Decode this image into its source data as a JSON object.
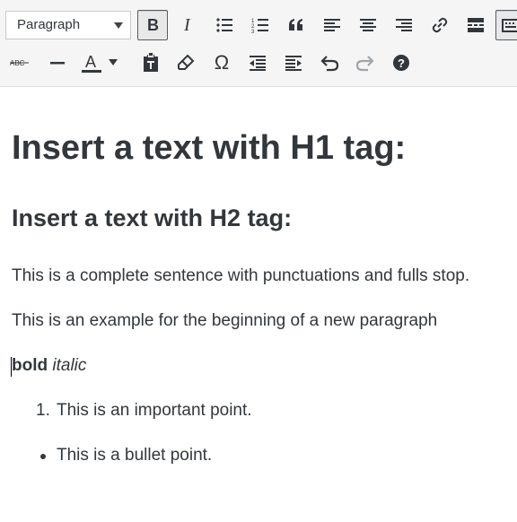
{
  "toolbar": {
    "format_select": {
      "value": "Paragraph"
    },
    "row1": [
      {
        "name": "bold-button",
        "icon": "bold-icon",
        "active": true
      },
      {
        "name": "italic-button",
        "icon": "italic-icon"
      },
      {
        "name": "bullet-list-button",
        "icon": "bullet-list-icon"
      },
      {
        "name": "numbered-list-button",
        "icon": "numbered-list-icon"
      },
      {
        "name": "blockquote-button",
        "icon": "blockquote-icon"
      },
      {
        "name": "align-left-button",
        "icon": "align-left-icon"
      },
      {
        "name": "align-center-button",
        "icon": "align-center-icon"
      },
      {
        "name": "align-right-button",
        "icon": "align-right-icon"
      },
      {
        "name": "insert-link-button",
        "icon": "link-icon"
      },
      {
        "name": "read-more-button",
        "icon": "read-more-icon"
      },
      {
        "name": "toolbar-toggle-button",
        "icon": "keyboard-icon"
      }
    ],
    "row2": [
      {
        "name": "strikethrough-button",
        "icon": "strikethrough-icon",
        "label": "ABC"
      },
      {
        "name": "horizontal-line-button",
        "icon": "horizontal-line-icon"
      },
      {
        "name": "text-color-button",
        "icon": "text-color-icon",
        "label": "A"
      },
      {
        "name": "paste-as-text-button",
        "icon": "paste-text-icon"
      },
      {
        "name": "clear-formatting-button",
        "icon": "eraser-icon"
      },
      {
        "name": "special-character-button",
        "icon": "omega-icon",
        "label": "Ω"
      },
      {
        "name": "decrease-indent-button",
        "icon": "outdent-icon"
      },
      {
        "name": "increase-indent-button",
        "icon": "indent-icon"
      },
      {
        "name": "undo-button",
        "icon": "undo-icon"
      },
      {
        "name": "redo-button",
        "icon": "redo-icon"
      },
      {
        "name": "help-button",
        "icon": "help-icon",
        "label": "?"
      }
    ]
  },
  "content": {
    "h1": "Insert a text with H1 tag:",
    "h2": "Insert a text with H2 tag:",
    "p1": "This is a complete sentence with punctuations and fulls stop.",
    "p2": "This is an example for the beginning of a new paragraph",
    "bold_text": "bold",
    "italic_text": "italic",
    "ordered_list": [
      {
        "number": "1.",
        "text": "This is an important point."
      }
    ],
    "bullet_list": [
      {
        "text": "This is a bullet point."
      }
    ]
  },
  "colors": {
    "icon": "#32373c",
    "toolbar_bg": "#f5f5f5",
    "text": "#32373c",
    "disabled": "#a0a5aa"
  }
}
